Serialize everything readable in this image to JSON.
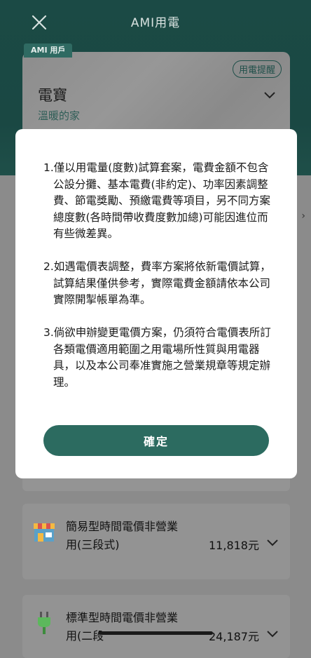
{
  "header": {
    "title": "AMI用電",
    "close_icon": "close-icon"
  },
  "account": {
    "user_tag": "AMI 用戶",
    "reminder_label": "用電提醒",
    "name": "電寶",
    "subtitle": "溫暖的家"
  },
  "modal": {
    "paragraphs": [
      "1.僅以用電量(度數)試算套案，電費金額不包含公設分攤、基本電費(非約定)、功率因素調整費、節電獎勵、預繳電費等項目，另不同方案總度數(各時間帶收費度數加總)可能因進位而有些微差異。",
      "2.如遇電價表調整，費率方案將依新電價試算，試算結果僅供參考，實際電費金額請依本公司實際開掣帳單為準。",
      "3.倘欲申辦變更電價方案，仍須符合電價表所訂各類電價適用範圍之用電場所性質與用電器具，以及本公司奉准實施之營業規章等規定辦理。"
    ],
    "confirm_label": "確定"
  },
  "plans": [
    {
      "title": "簡易型時間電價非營業用(三段式)",
      "amount": "11,818元",
      "icon": "store-icon"
    },
    {
      "title": "標準型時間電價非營業用(二段",
      "amount": "24,187元",
      "icon": "plug-icon"
    }
  ],
  "colors": {
    "header_bg": "#1b4a45",
    "accent": "#2c6b60",
    "overlay": "#8b8b8b"
  }
}
